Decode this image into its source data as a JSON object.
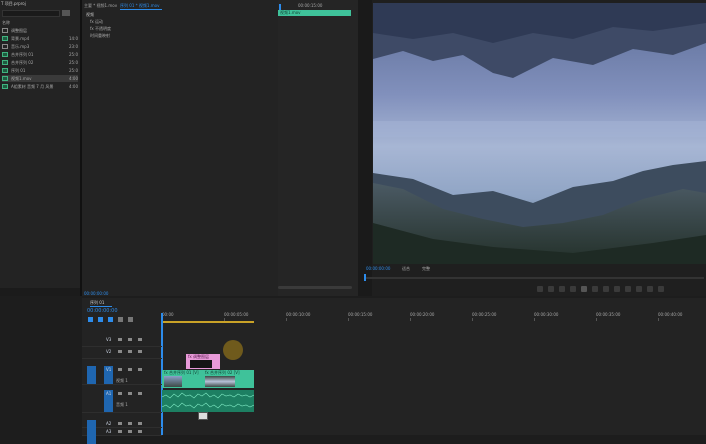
{
  "project": {
    "title": "T 项目.prproj",
    "items": [
      {
        "name": "调整图层",
        "type": "adj",
        "dur": ""
      },
      {
        "name": "背景.mp4",
        "type": "video",
        "dur": "14:0"
      },
      {
        "name": "音乐.mp3",
        "type": "audio",
        "dur": "23:0"
      },
      {
        "name": "合并序列 01",
        "type": "seq",
        "dur": "25:0"
      },
      {
        "name": "合并序列 02",
        "type": "seq",
        "dur": "25:0"
      },
      {
        "name": "序列 01",
        "type": "seq",
        "dur": "25:0"
      },
      {
        "name": "视频1.mov",
        "type": "video",
        "dur": "4:00",
        "selected": true
      },
      {
        "name": "A组素材 音频 7 月 风景",
        "type": "video",
        "dur": "4:00"
      }
    ],
    "header_label": "名称"
  },
  "effect_controls": {
    "tab1": "主要 * 视频1.mov",
    "tab2": "序列 01 * 视频1.mov",
    "header": "视频",
    "rows": [
      "fx  运动",
      "fx  不透明度",
      "时间重映射"
    ],
    "timecode": "00:00:00:00",
    "mini_timecode": "00:00:15:00",
    "clip_label": "视频1.mov"
  },
  "program": {
    "timecode": "00:00:00:00",
    "fit_label": "适合",
    "quality": "完整"
  },
  "timeline": {
    "tab": "序列 01",
    "timecode": "00:00:00:00",
    "ruler": [
      "00:00",
      "00:00:05:00",
      "00:00:10:00",
      "00:00:15:00",
      "00:00:20:00",
      "00:00:25:00",
      "00:00:30:00",
      "00:00:35:00",
      "00:00:40:00"
    ],
    "tracks": [
      "V3",
      "V2",
      "V1",
      "A1",
      "A2",
      "A3"
    ],
    "v1_label": "视频 1",
    "a1_label": "音频 1",
    "pink_clip": "fx 调整图层",
    "video_clip_a": "fx 合并序列 01 [V]",
    "video_clip_b": "fx 合并序列 02 [V]"
  },
  "colors": {
    "accent": "#2d8ceb",
    "clip_teal": "#3fc29a",
    "clip_pink": "#e89ad8",
    "audio_green": "#1d7f62"
  }
}
